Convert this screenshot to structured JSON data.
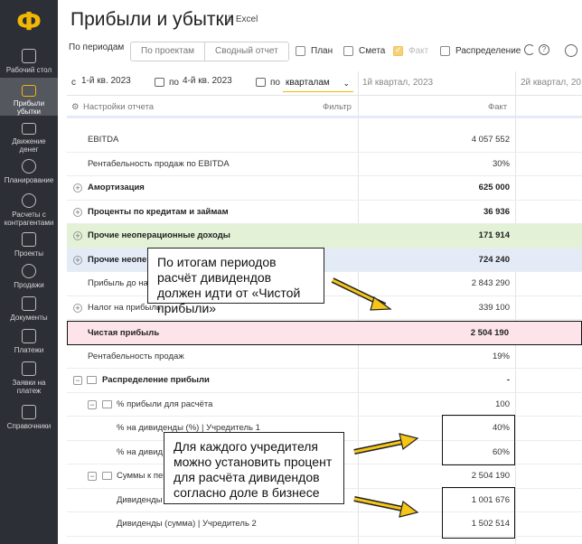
{
  "sidebar": {
    "logo": "Ф",
    "items": [
      {
        "label": "Рабочий стол",
        "icon": "dashboard-icon"
      },
      {
        "label": "Прибыли убытки",
        "icon": "chart-bars-icon",
        "active": true
      },
      {
        "label": "Движение денег",
        "icon": "money-flow-icon"
      },
      {
        "label": "Планирование",
        "icon": "target-icon"
      },
      {
        "label": "Расчеты с контрагентами",
        "icon": "people-icon"
      },
      {
        "label": "Проекты",
        "icon": "briefcase-icon"
      },
      {
        "label": "Продажи",
        "icon": "dollar-icon"
      },
      {
        "label": "Документы",
        "icon": "documents-icon"
      },
      {
        "label": "Платежи",
        "icon": "wallet-icon"
      },
      {
        "label": "Заявки на платеж",
        "icon": "request-icon"
      },
      {
        "label": "Справочники",
        "icon": "folder-icon"
      }
    ]
  },
  "header": {
    "title": "Прибыли и убытки",
    "excel_label": "Excel"
  },
  "toolbar": {
    "by_periods": "По периодам",
    "by_projects": "По проектам",
    "summary": "Сводный отчет",
    "plan": "План",
    "estimate": "Смета",
    "fact": "Факт",
    "distribution": "Распределение"
  },
  "period": {
    "from_label": "с",
    "from_value": "1-й кв. 2023",
    "to_label": "по",
    "to_value": "4-й кв. 2023",
    "by_label": "по",
    "granularity": "кварталам"
  },
  "table": {
    "col1": "1й квартал, 2023",
    "col2": "2й квартал, 20",
    "col1_sub": "Факт",
    "settings": "Настройки отчета",
    "filter": "Фильтр",
    "rows": [
      {
        "label": "EBITDA",
        "value": "4 057 552"
      },
      {
        "label": "Рентабельность продаж по EBITDA",
        "value": "30%"
      },
      {
        "label": "Амортизация",
        "value": "625 000"
      },
      {
        "label": "Проценты по кредитам и займам",
        "value": "36 936"
      },
      {
        "label": "Прочие неоперационные доходы",
        "value": "171 914"
      },
      {
        "label": "Прочие неопе",
        "value": "724 240"
      },
      {
        "label": "Прибыль до на",
        "value": "2 843 290"
      },
      {
        "label": "Налог на прибыль",
        "value": "339 100"
      },
      {
        "label": "Чистая прибыль",
        "value": "2 504 190"
      },
      {
        "label": "Рентабельность продаж",
        "value": "19%"
      },
      {
        "label": "Распределение прибыли",
        "value": "-"
      },
      {
        "label": "% прибыли для расчёта",
        "value": "100"
      },
      {
        "label": "% на дивиденды (%) | Учредитель 1",
        "value": "40%"
      },
      {
        "label": "% на дивид",
        "value": "60%"
      },
      {
        "label": "Суммы к пер",
        "value": "2 504 190"
      },
      {
        "label": "Дивиденды (сумма) | Учредитель 1",
        "value": "1 001 676"
      },
      {
        "label": "Дивиденды (сумма) | Учредитель 2",
        "value": "1 502 514"
      }
    ]
  },
  "notes": {
    "top": "По итогам периодов расчёт дивидендов должен идти от «Чистой прибыли»",
    "bottom": "Для каждого учредителя можно установить процент для расчёта дивидендов согласно доле в бизнесе"
  },
  "colors": {
    "accent": "#f2b705",
    "sidebar": "#2d2f36",
    "green_row": "#e3f2d6",
    "blue_row": "#e3ebf7",
    "pink_row": "#fce4ea"
  }
}
